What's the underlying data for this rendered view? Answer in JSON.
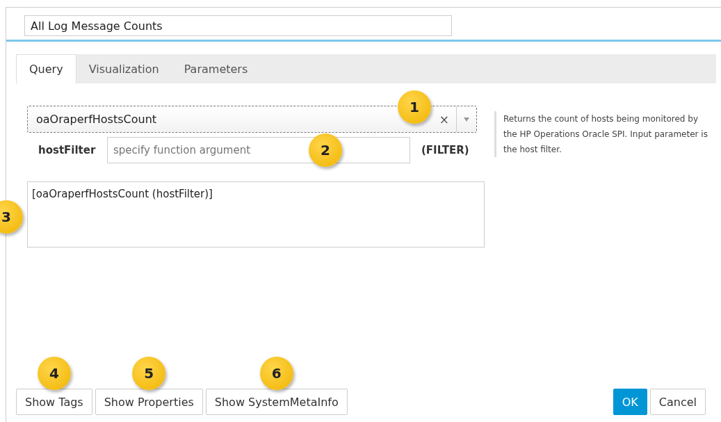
{
  "title_field": {
    "value": "All Log Message Counts"
  },
  "tabs": [
    {
      "label": "Query",
      "selected": true
    },
    {
      "label": "Visualization",
      "selected": false
    },
    {
      "label": "Parameters",
      "selected": false
    }
  ],
  "function_select": {
    "value": "oaOraperfHostsCount",
    "clear": "×",
    "callout": "1"
  },
  "argument": {
    "label": "hostFilter",
    "placeholder": "specify function argument",
    "type": "(FILTER)",
    "callout": "2"
  },
  "description": "Returns the count of hosts being monitored by the HP Operations Oracle SPI. Input parameter is the host filter.",
  "expression": {
    "value": "[oaOraperfHostsCount (hostFilter)]",
    "callout": "3"
  },
  "left_buttons": [
    {
      "label": "Show Tags",
      "callout": "4"
    },
    {
      "label": "Show Properties",
      "callout": "5"
    },
    {
      "label": "Show SystemMetaInfo",
      "callout": "6"
    }
  ],
  "right_buttons": [
    {
      "label": "OK",
      "kind": "primary"
    },
    {
      "label": "Cancel",
      "kind": "default"
    }
  ]
}
